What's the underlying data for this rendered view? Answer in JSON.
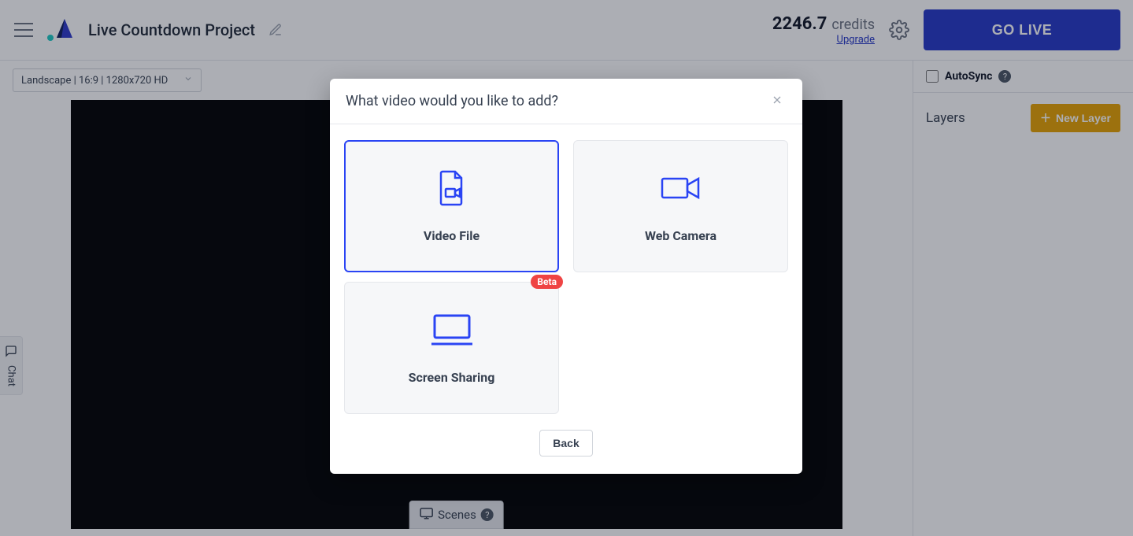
{
  "header": {
    "title": "Live Countdown Project",
    "credits_amount": "2246.7",
    "credits_label": "credits",
    "upgrade": "Upgrade",
    "go_live": "GO LIVE"
  },
  "canvas": {
    "format": "Landscape | 16:9 | 1280x720 HD",
    "scenes_label": "Scenes"
  },
  "sidebar": {
    "autosync_label": "AutoSync",
    "layers_title": "Layers",
    "new_layer": "New Layer"
  },
  "chat": {
    "label": "Chat"
  },
  "modal": {
    "title": "What video would you like to add?",
    "options": {
      "video_file": "Video File",
      "web_camera": "Web Camera",
      "screen_sharing": "Screen Sharing",
      "beta": "Beta"
    },
    "back": "Back"
  }
}
